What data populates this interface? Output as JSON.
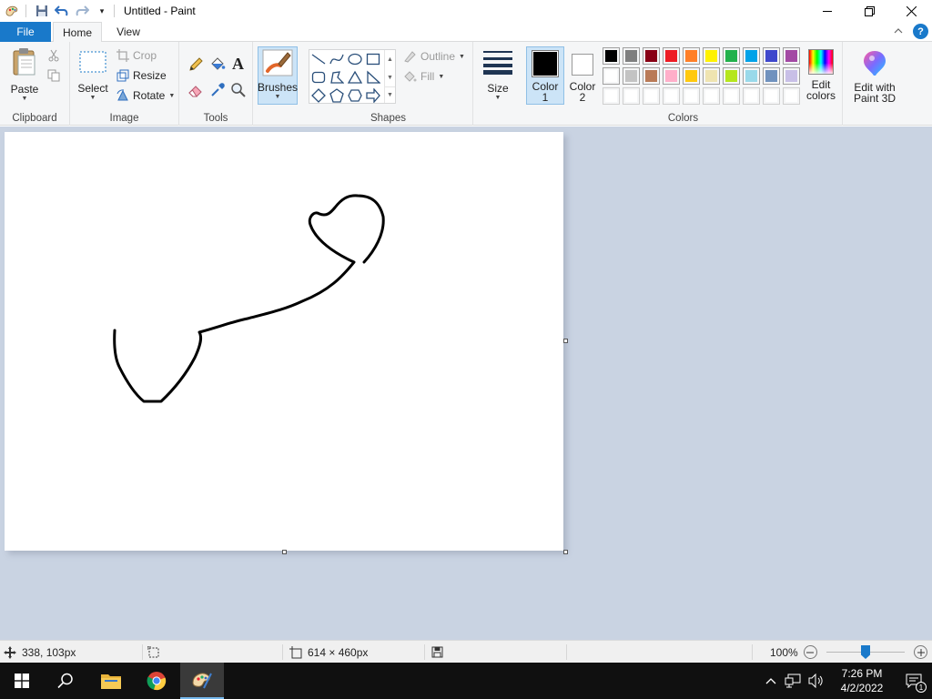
{
  "window": {
    "title": "Untitled - Paint"
  },
  "tabs": {
    "file": "File",
    "home": "Home",
    "view": "View"
  },
  "ribbon": {
    "clipboard": {
      "label": "Clipboard",
      "paste": "Paste"
    },
    "image": {
      "label": "Image",
      "select": "Select",
      "crop": "Crop",
      "resize": "Resize",
      "rotate": "Rotate"
    },
    "tools": {
      "label": "Tools"
    },
    "brushes": "Brushes",
    "shapes": {
      "label": "Shapes",
      "outline": "Outline",
      "fill": "Fill"
    },
    "size": "Size",
    "color1": {
      "line1": "Color",
      "line2": "1",
      "value": "#000000"
    },
    "color2": {
      "line1": "Color",
      "line2": "2",
      "value": "#ffffff"
    },
    "colors": {
      "label": "Colors",
      "row1": [
        "#000000",
        "#7f7f7f",
        "#880015",
        "#ed1c24",
        "#ff7f27",
        "#fff200",
        "#22b14c",
        "#00a2e8",
        "#3f48cc",
        "#a349a4"
      ],
      "row2": [
        "#ffffff",
        "#c3c3c3",
        "#b97a57",
        "#ffaec9",
        "#ffc90e",
        "#efe4b0",
        "#b5e61d",
        "#99d9ea",
        "#7092be",
        "#c8bfe7"
      ],
      "row3": [
        "#ffffff",
        "#ffffff",
        "#ffffff",
        "#ffffff",
        "#ffffff",
        "#ffffff",
        "#ffffff",
        "#ffffff",
        "#ffffff",
        "#ffffff"
      ]
    },
    "edit_colors": {
      "line1": "Edit",
      "line2": "colors"
    },
    "paint3d": {
      "line1": "Edit with",
      "line2": "Paint 3D"
    }
  },
  "status": {
    "cursor_pos": "338, 103px",
    "canvas_size": "614 × 460px",
    "zoom": "100%",
    "zoom_level": 0.5
  },
  "taskbar": {
    "time": "7:26 PM",
    "date": "4/2/2022",
    "notification_count": "1"
  }
}
